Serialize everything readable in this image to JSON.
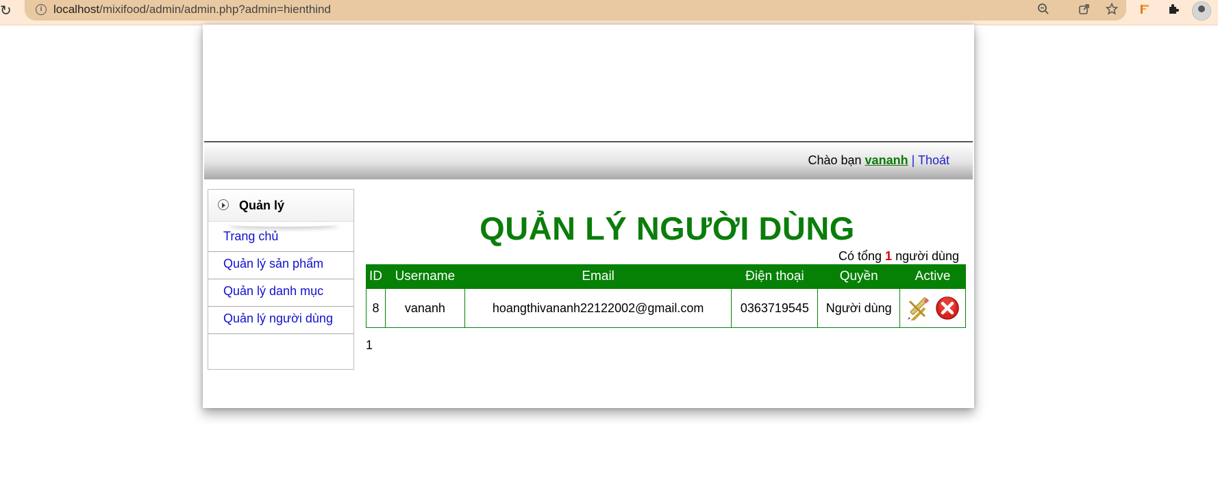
{
  "browser": {
    "url_host": "localhost",
    "url_path": "/mixifood/admin/admin.php?admin=hienthind",
    "icons": [
      "reload-icon",
      "info-icon",
      "zoom-out-icon",
      "share-icon",
      "star-icon",
      "bookmark-icon",
      "extensions-icon",
      "profile-avatar"
    ]
  },
  "userbar": {
    "greeting": "Chào bạn",
    "username": "vananh",
    "separator": "|",
    "logout": "Thoát"
  },
  "sidebar": {
    "title": "Quản lý",
    "items": [
      {
        "label": "Trang chủ"
      },
      {
        "label": "Quản lý sản phẩm"
      },
      {
        "label": "Quản lý danh mục"
      },
      {
        "label": "Quản lý người dùng"
      }
    ]
  },
  "main": {
    "title": "QUẢN LÝ NGƯỜI DÙNG",
    "total_prefix": "Có tổng",
    "total_count": "1",
    "total_suffix": "người dùng",
    "columns": [
      "ID",
      "Username",
      "Email",
      "Điện thoại",
      "Quyền",
      "Active"
    ],
    "rows": [
      {
        "id": "8",
        "username": "vananh",
        "email": "hoangthivananh22122002@gmail.com",
        "phone": "0363719545",
        "role": "Người dùng"
      }
    ],
    "pagination": "1"
  },
  "colors": {
    "accent_green": "#068106",
    "title_green": "#0a7d0a",
    "link_blue": "#1010d0",
    "count_red": "#e00000"
  }
}
